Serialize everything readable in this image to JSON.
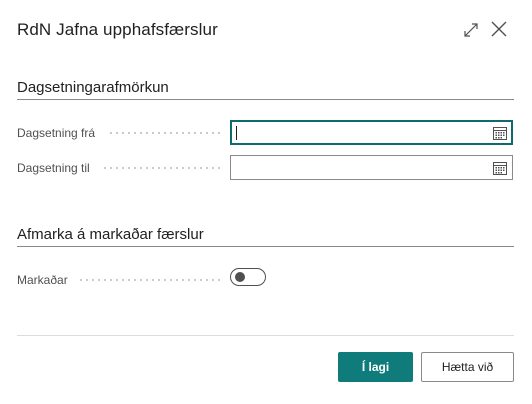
{
  "dialog": {
    "title": "RdN Jafna upphafsfærslur",
    "icons": {
      "expand": "expand-icon",
      "close": "close-icon"
    }
  },
  "date_section": {
    "title": "Dagsetningarafmörkun",
    "fields": [
      {
        "label": "Dagsetning frá",
        "value": "",
        "icon": "calendar-icon",
        "focused": true
      },
      {
        "label": "Dagsetning til",
        "value": "",
        "icon": "calendar-icon",
        "focused": false
      }
    ]
  },
  "marked_section": {
    "title": "Afmarka á markaðar færslur",
    "toggle_label": "Markaðar",
    "toggle_on": false
  },
  "footer": {
    "ok_label": "Í lagi",
    "cancel_label": "Hætta við"
  },
  "colors": {
    "accent": "#0f7b7b",
    "focus_border": "#0f6b6b",
    "text": "#212121",
    "label": "#505050"
  }
}
